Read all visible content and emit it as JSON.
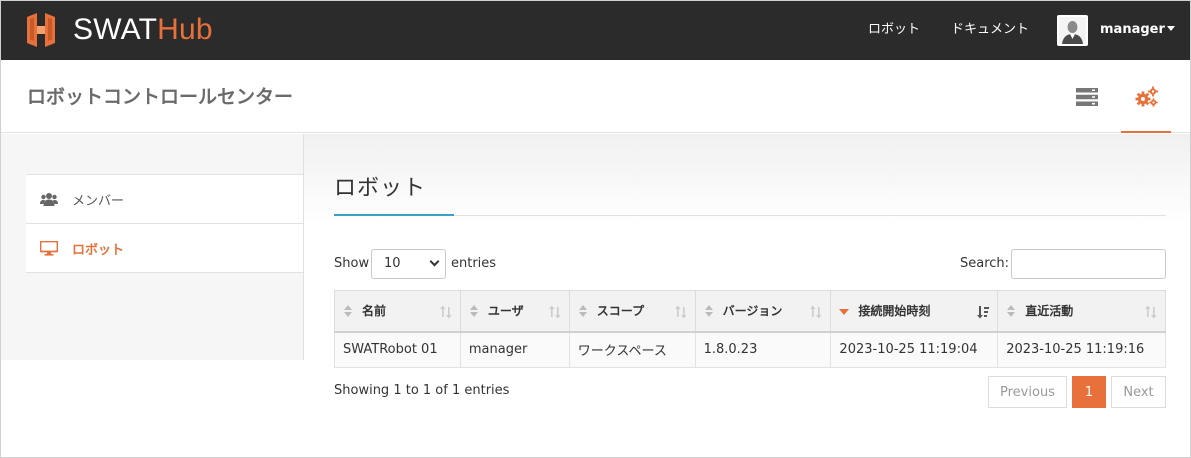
{
  "app": {
    "brand_left": "SWAT",
    "brand_right": "Hub",
    "nav": [
      "ロボット",
      "ドキュメント"
    ],
    "user": "manager",
    "accent_color": "#e8703a",
    "navbar_color": "#2b2b2b"
  },
  "header": {
    "title": "ロボットコントロールセンター",
    "icons": [
      "server-list-icon",
      "gears-icon"
    ]
  },
  "sidebar": {
    "items": [
      {
        "label": "メンバー",
        "icon": "users-icon",
        "active": false
      },
      {
        "label": "ロボット",
        "icon": "monitor-icon",
        "active": true
      }
    ]
  },
  "main": {
    "title": "ロボット",
    "show_label": "Show",
    "entries_label": "entries",
    "page_length": "10",
    "search_label": "Search:",
    "search_value": "",
    "columns": [
      "名前",
      "ユーザ",
      "スコープ",
      "バージョン",
      "接続開始時刻",
      "直近活動"
    ],
    "sorted_column": "接続開始時刻",
    "rows": [
      [
        "SWATRobot 01",
        "manager",
        "ワークスペース",
        "1.8.0.23",
        "2023-10-25 11:19:04",
        "2023-10-25 11:19:16"
      ]
    ],
    "info": "Showing 1 to 1 of 1 entries",
    "pagination": {
      "previous": "Previous",
      "current": "1",
      "next": "Next"
    }
  }
}
